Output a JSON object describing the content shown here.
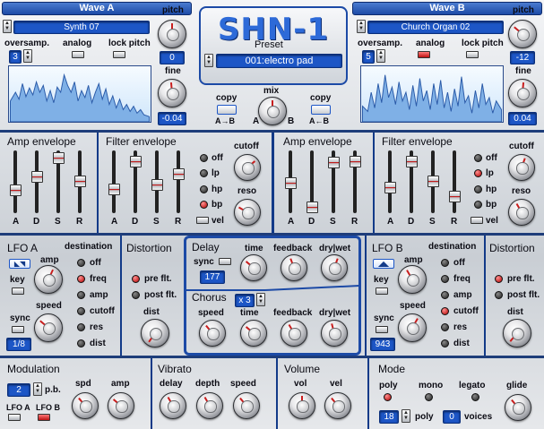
{
  "app": {
    "logo": "SHN-1",
    "preset_label": "Preset",
    "preset_value": "001:electro pad"
  },
  "waveA": {
    "header": "Wave A",
    "name": "Synth 07",
    "oversamp_label": "oversamp.",
    "oversamp_value": "3",
    "analog_label": "analog",
    "lockpitch_label": "lock pitch",
    "pitch_label": "pitch",
    "pitch_value": "0",
    "fine_label": "fine",
    "fine_value": "-0.04"
  },
  "waveB": {
    "header": "Wave B",
    "name": "Church Organ 02",
    "oversamp_label": "oversamp.",
    "oversamp_value": "5",
    "analog_label": "analog",
    "lockpitch_label": "lock pitch",
    "pitch_label": "pitch",
    "pitch_value": "-12",
    "fine_label": "fine",
    "fine_value": "0.04"
  },
  "mix": {
    "label": "mix",
    "a": "A",
    "b": "B",
    "copy_label": "copy",
    "copy_ab": "A→B",
    "copy_ba": "A←B"
  },
  "env": {
    "amp_title": "Amp envelope",
    "filter_title": "Filter envelope",
    "adsr": [
      "A",
      "D",
      "S",
      "R"
    ],
    "filter_modes": [
      "off",
      "lp",
      "hp",
      "bp"
    ],
    "vel": "vel",
    "cutoff": "cutoff",
    "reso": "reso"
  },
  "lfoA": {
    "title": "LFO A",
    "amp": "amp",
    "key": "key",
    "speed": "speed",
    "sync": "sync",
    "sync_value": "1/8",
    "dest_title": "destination",
    "dests": [
      "off",
      "freq",
      "amp",
      "cutoff",
      "res",
      "dist"
    ]
  },
  "lfoB": {
    "title": "LFO B",
    "amp": "amp",
    "key": "key",
    "speed": "speed",
    "sync": "sync",
    "sync_value": "943",
    "dest_title": "destination",
    "dests": [
      "off",
      "freq",
      "amp",
      "cutoff",
      "res",
      "dist"
    ]
  },
  "distA": {
    "title": "Distortion",
    "pre": "pre flt.",
    "post": "post flt.",
    "dist": "dist"
  },
  "distB": {
    "title": "Distortion",
    "pre": "pre flt.",
    "post": "post flt.",
    "dist": "dist"
  },
  "delay": {
    "title": "Delay",
    "sync": "sync",
    "sync_value": "177",
    "time": "time",
    "feedback": "feedback",
    "drywet": "dry|wet"
  },
  "chorus": {
    "title": "Chorus",
    "mult": "x 3",
    "speed": "speed",
    "time": "time",
    "feedback": "feedback",
    "drywet": "dry|wet"
  },
  "modulation": {
    "title": "Modulation",
    "value": "2",
    "pb": "p.b.",
    "spd": "spd",
    "amp": "amp",
    "lfoa": "LFO A",
    "lfob": "LFO B"
  },
  "vibrato": {
    "title": "Vibrato",
    "delay": "delay",
    "depth": "depth",
    "speed": "speed"
  },
  "volume": {
    "title": "Volume",
    "vol": "vol",
    "vel": "vel"
  },
  "mode": {
    "title": "Mode",
    "poly": "poly",
    "mono": "mono",
    "legato": "legato",
    "glide": "glide",
    "poly_value": "18",
    "poly_label": "poly",
    "voices_value": "0",
    "voices_label": "voices"
  }
}
